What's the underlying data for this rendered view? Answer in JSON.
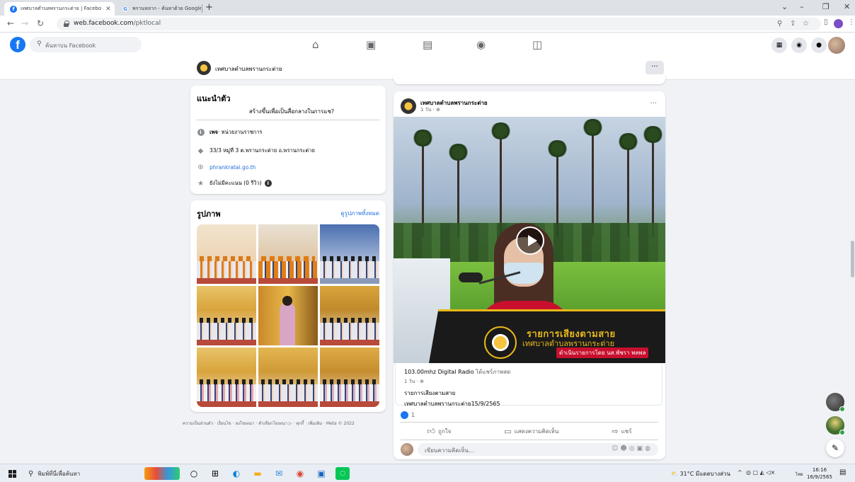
{
  "browser": {
    "tabs": [
      {
        "title": "เทศบาลตำบลพรานกระต่าย | Facebo",
        "active": true
      },
      {
        "title": "พรานหลาก - ค้นหาด้วย Google",
        "active": false
      }
    ],
    "new_tab": "+",
    "url_host": "web.facebook.com",
    "url_path": "/pktlocal"
  },
  "fb": {
    "search_placeholder": "ค้นหาบน Facebook",
    "page_name": "เทศบาลตำบลพรานกระต่าย",
    "more": "···"
  },
  "intro": {
    "title": "แนะนำตัว",
    "bio": "สร้างขึ้นเพื่อเป็นสื่อกลางในการแช?",
    "page_type_bold": "เพจ",
    "page_type_rest": " · หน่วยงานราชการ",
    "address": "33/3 หมู่ที่ 3 ต.พรานกระต่าย อ.พรานกระต่าย",
    "website": "phrankratai.go.th",
    "rating": "ยังไม่มีคะแนน (0 รีวิว)"
  },
  "photos": {
    "title": "รูปภาพ",
    "see_all": "ดูรูปภาพทั้งหมด"
  },
  "footer": "ความเป็นส่วนตัว · เงื่อนไข · ลงโฆษณา · ตัวเลือกโฆษณา ▷ · คุกกี้ · เพิ่มเติม · Meta © 2022",
  "post": {
    "author": "เทศบาลตำบลพรานกระต่าย",
    "time": "1 วัน · ⊕",
    "video_banner_1": "รายการเสียงตามสาย",
    "video_banner_2": "เทศบาลตำบลพรานกระต่าย",
    "video_banner_3": "ดำเนินรายการโดย นส.พัชรา พลพล",
    "shared_source": "103.00mhz Digital Radio",
    "shared_action": " ได้แชร์ภาพสด",
    "shared_time": "1 วัน · ⊕",
    "shared_line1": "รายการเสียงตามสาย",
    "shared_line2": "เทศบาลตำบลพรานกระต่าย15/9/2565",
    "reaction_count": "1",
    "like": "ถูกใจ",
    "comment": "แสดงความคิดเห็น",
    "share": "แชร์",
    "comment_placeholder": "เขียนความคิดเห็น..."
  },
  "taskbar": {
    "search": "พิมพ์ที่นี่เพื่อค้นหา",
    "weather": "31°C มีแดดบางส่วน",
    "lang": "ไทย",
    "time": "16:16",
    "date": "16/9/2565"
  }
}
